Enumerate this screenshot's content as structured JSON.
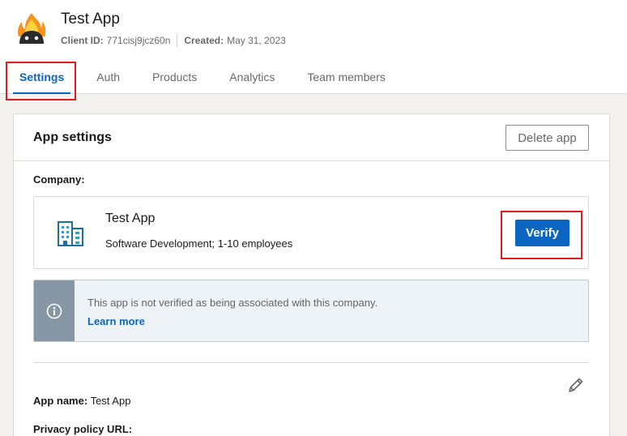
{
  "app": {
    "name": "Test App",
    "client_id_label": "Client ID:",
    "client_id": "771cisj9jcz60n",
    "created_label": "Created:",
    "created": "May 31, 2023",
    "logo_icon": "fire-robot-logo-icon"
  },
  "tabs": [
    {
      "label": "Settings",
      "active": true
    },
    {
      "label": "Auth",
      "active": false
    },
    {
      "label": "Products",
      "active": false
    },
    {
      "label": "Analytics",
      "active": false
    },
    {
      "label": "Team members",
      "active": false
    }
  ],
  "settings": {
    "title": "App settings",
    "delete_label": "Delete app",
    "company_label": "Company:",
    "company": {
      "name": "Test App",
      "description": "Software Development; 1-10 employees",
      "icon": "building-icon"
    },
    "verify_label": "Verify",
    "notice": {
      "text": "This app is not verified as being associated with this company.",
      "link": "Learn more",
      "icon": "info-icon"
    },
    "fields": {
      "app_name_label": "App name:",
      "app_name_value": "Test App",
      "privacy_label": "Privacy policy URL:"
    }
  },
  "colors": {
    "accent": "#0a66c2",
    "highlight": "#e01c1c",
    "background": "#f3f2ef",
    "notice_bg": "#eef3f8",
    "notice_side": "#8696a5"
  }
}
